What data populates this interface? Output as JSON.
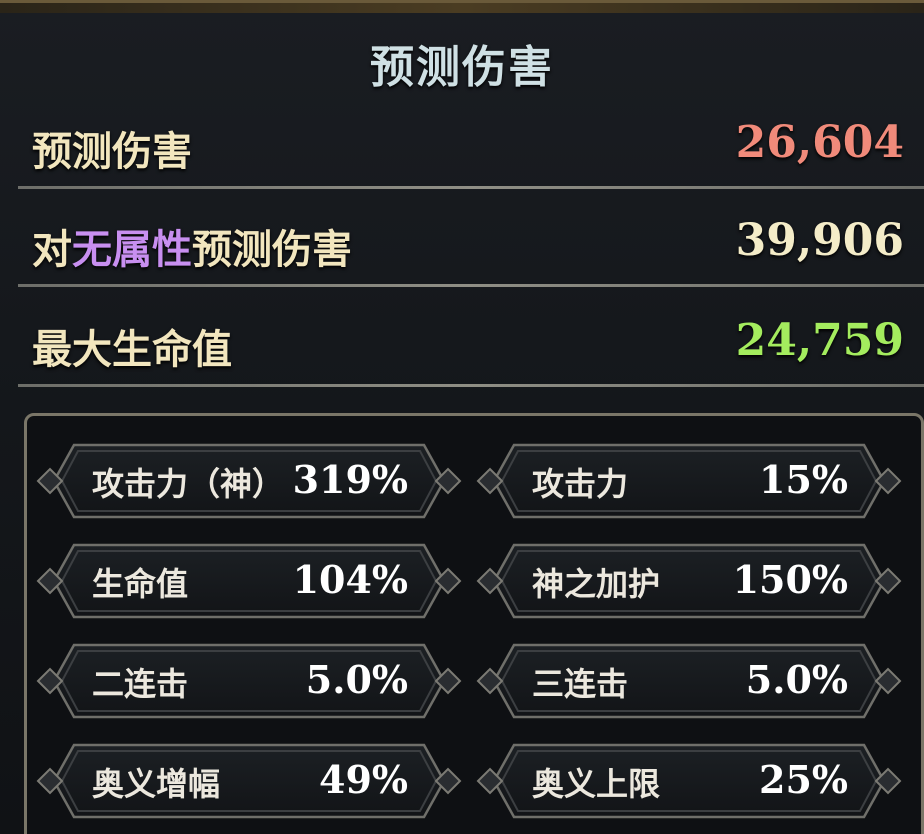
{
  "title": "预测伤害",
  "summary": [
    {
      "label": "预测伤害",
      "value": "26,604",
      "color": "#f08a7a"
    },
    {
      "label_prefix": "对",
      "label_accent": "无属性",
      "label_suffix": "预测伤害",
      "value": "39,906",
      "color": "#f4ecc8"
    },
    {
      "label": "最大生命值",
      "value": "24,759",
      "color": "#a4ec5e"
    }
  ],
  "stats": [
    {
      "label": "攻击力（神）",
      "value": "319%"
    },
    {
      "label": "攻击力",
      "value": "15%"
    },
    {
      "label": "生命值",
      "value": "104%"
    },
    {
      "label": "神之加护",
      "value": "150%"
    },
    {
      "label": "二连击",
      "value": "5.0%"
    },
    {
      "label": "三连击",
      "value": "5.0%"
    },
    {
      "label": "奥义增幅",
      "value": "49%"
    },
    {
      "label": "奥义上限",
      "value": "25%"
    }
  ]
}
